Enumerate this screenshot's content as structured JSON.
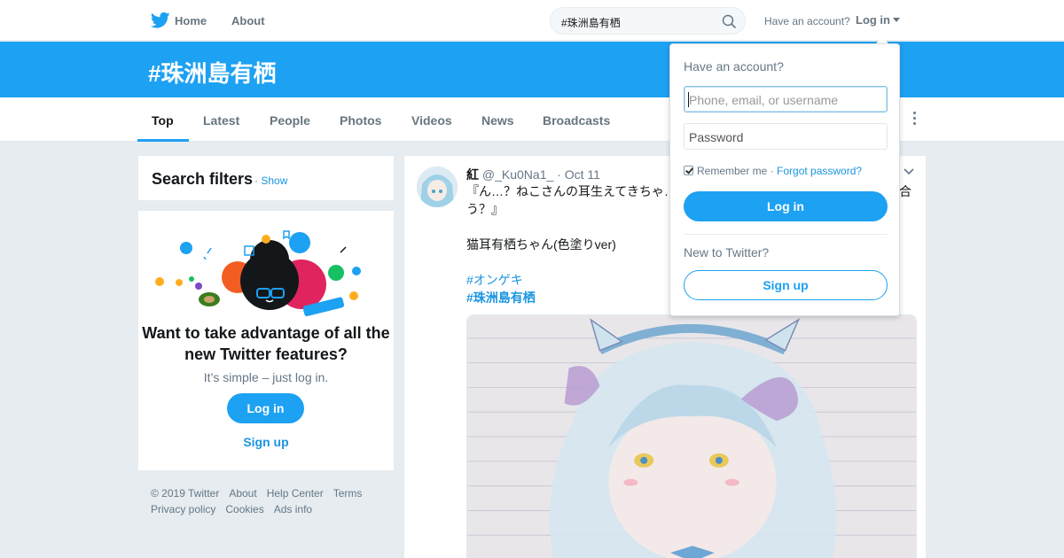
{
  "nav": {
    "logo_icon": "twitter-bird-icon",
    "home_label": "Home",
    "about_label": "About",
    "search_value": "#珠洲島有栖",
    "search_icon": "search-icon",
    "have_account": "Have an account?",
    "login_label": "Log in"
  },
  "banner": {
    "title": "#珠洲島有栖"
  },
  "tabs": [
    {
      "label": "Top",
      "active": true
    },
    {
      "label": "Latest"
    },
    {
      "label": "People"
    },
    {
      "label": "Photos"
    },
    {
      "label": "Videos"
    },
    {
      "label": "News"
    },
    {
      "label": "Broadcasts"
    }
  ],
  "filters": {
    "title": "Search filters",
    "separator": " · ",
    "show": "Show"
  },
  "promo": {
    "title": "Want to take advantage of all the new Twitter features?",
    "subtitle": "It’s simple – just log in.",
    "login": "Log in",
    "signup": "Sign up"
  },
  "footer": {
    "line1": [
      "© 2019 Twitter",
      "About",
      "Help Center",
      "Terms"
    ],
    "line2": [
      "Privacy policy",
      "Cookies",
      "Ads info"
    ]
  },
  "tweet": {
    "name": "紅",
    "handle": "@_Ku0Na1_",
    "separator": "·",
    "date": "Oct 11",
    "line1": "『ん…？ねこさんの耳生えてきちゃ…",
    "line1_end": "合",
    "line2": "う？』",
    "line3": "猫耳有栖ちゃん(色塗りver)",
    "hashtag1": "#オンゲキ",
    "hashtag2": "#珠洲島有栖"
  },
  "login_dropdown": {
    "heading": "Have an account?",
    "username_placeholder": "Phone, email, or username",
    "password_placeholder": "Password",
    "remember": "Remember me",
    "separator": " · ",
    "forgot": "Forgot password?",
    "login": "Log in",
    "new_to": "New to Twitter?",
    "signup": "Sign up"
  },
  "colors": {
    "brand": "#1da1f2",
    "link": "#1b95e0",
    "background": "#e6ecf0"
  }
}
